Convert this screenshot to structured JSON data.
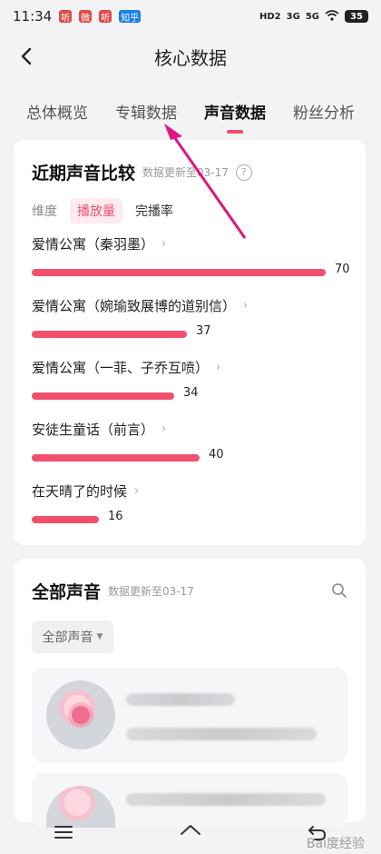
{
  "status": {
    "time": "11:34",
    "notifications": [
      "听",
      "微",
      "听",
      "知乎"
    ],
    "icons": [
      "HD2",
      "3G",
      "5G",
      "wifi"
    ],
    "battery": "35"
  },
  "header": {
    "title": "核心数据"
  },
  "tabs": [
    {
      "label": "总体概览"
    },
    {
      "label": "专辑数据"
    },
    {
      "label": "声音数据"
    },
    {
      "label": "粉丝分析"
    }
  ],
  "recent": {
    "title": "近期声音比较",
    "updated": "数据更新至03-17",
    "help": "?",
    "dimension_label": "维度",
    "metric_active": "播放量",
    "metric_other": "完播率"
  },
  "chart_data": {
    "type": "bar",
    "categories": [
      "爱情公寓（秦羽墨）",
      "爱情公寓（婉瑜致展博的道别信）",
      "爱情公寓（一菲、子乔互喷）",
      "安徒生童话（前言）",
      "在天晴了的时候"
    ],
    "values": [
      70,
      37,
      34,
      40,
      16
    ]
  },
  "all": {
    "title": "全部声音",
    "updated": "数据更新至03-17",
    "filter": "全部声音"
  },
  "colors": {
    "accent": "#f0506e",
    "background": "#f3f3f5"
  },
  "watermark": "Bai度经验"
}
